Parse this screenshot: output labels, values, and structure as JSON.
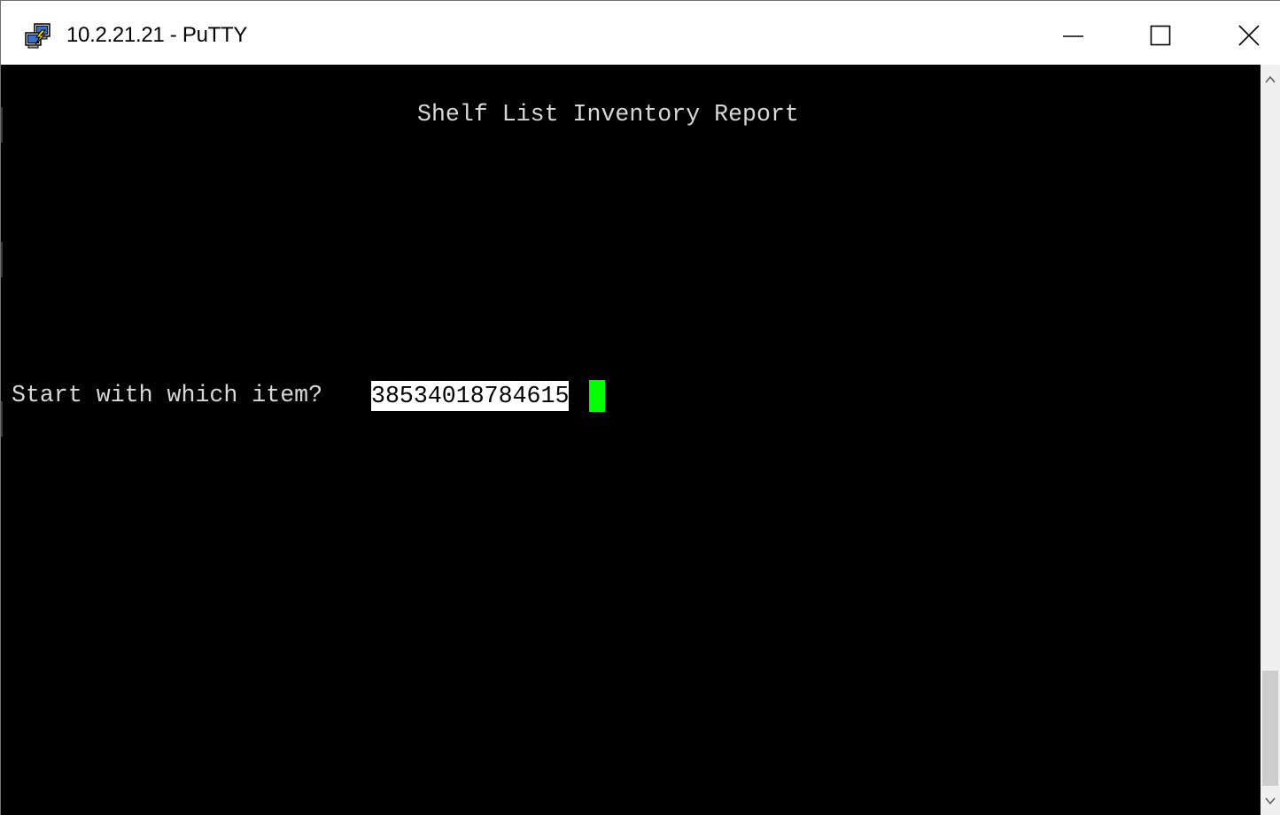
{
  "window": {
    "title": "10.2.21.21 - PuTTY",
    "app_icon": "putty-icon",
    "controls": {
      "minimize_icon": "minimize-icon",
      "maximize_icon": "maximize-icon",
      "close_icon": "close-icon"
    }
  },
  "terminal": {
    "report_title": "Shelf List Inventory Report",
    "prompt_label": "Start with which item?",
    "input_value": "38534018784615",
    "colors": {
      "background": "#000000",
      "text": "#d8d8d8",
      "input_background": "#ffffff",
      "cursor": "#00ff00"
    }
  },
  "scrollbar": {
    "up_icon": "chevron-up-icon",
    "down_icon": "chevron-down-icon"
  }
}
